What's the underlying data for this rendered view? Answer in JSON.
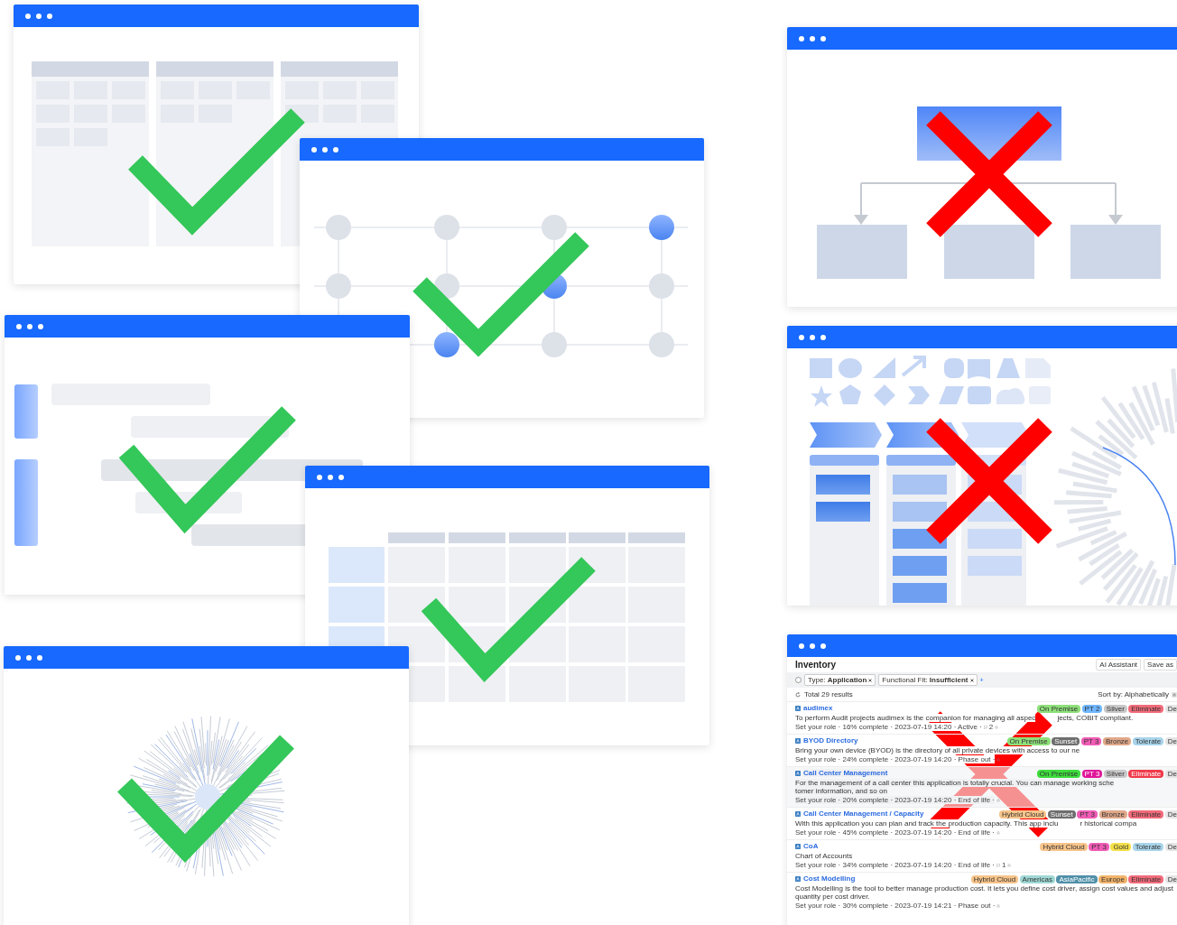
{
  "windows": [
    {
      "kind": "board",
      "approved": true
    },
    {
      "kind": "network",
      "approved": true
    },
    {
      "kind": "gantt",
      "approved": true
    },
    {
      "kind": "table",
      "approved": true
    },
    {
      "kind": "burst",
      "approved": true
    },
    {
      "kind": "flowchart",
      "approved": false
    },
    {
      "kind": "shapes",
      "approved": false
    },
    {
      "kind": "inventory",
      "approved": false,
      "inventory": {
        "title": "Inventory",
        "actions": [
          "AI Assistant",
          "Save as"
        ],
        "filters": [
          "Type: **Application**",
          "Functional Fit: **Insufficient**"
        ],
        "add_filter": "+",
        "total": "Total 29 results",
        "sort": "Sort by: Alphabetically",
        "items": [
          {
            "name": "audimex",
            "selected": false,
            "description": [
              "To perform Audit projects audimex is the companion for managing all aspec",
              "jects, COBIT compliant."
            ],
            "meta": "Set your role · 16% complete · 2023-07-19 14:20 · Active ·",
            "comments": "2",
            "tags": [
              {
                "label": "On Premise",
                "color": "#8ee07a"
              },
              {
                "label": "PT 2",
                "color": "#6fb6ff"
              },
              {
                "label": "Silver",
                "color": "#c8c8c8"
              },
              {
                "label": "Eliminate",
                "color": "#f26b7a"
              },
              {
                "label": "De",
                "color": "#e5e5e5"
              }
            ]
          },
          {
            "name": "BYOD Directory",
            "selected": false,
            "description": [
              "Bring your own device (BYOD) is the directory of all private devices with access to our ne"
            ],
            "meta": "Set your role · 24% complete · 2023-07-19 14:20 · Phase out ·",
            "tags": [
              {
                "label": "On Premise",
                "color": "#8ee07a"
              },
              {
                "label": "Sunset",
                "color": "#6e6e6e"
              },
              {
                "label": "PT 3",
                "color": "#f05cb5"
              },
              {
                "label": "Bronze",
                "color": "#e0a88a"
              },
              {
                "label": "Tolerate",
                "color": "#a8d4ea"
              },
              {
                "label": "De",
                "color": "#e5e5e5"
              }
            ]
          },
          {
            "name": "Call Center Management",
            "selected": true,
            "description": [
              "For the management of a call center this application is totally crucial. You can manage working sche",
              "tomer information, and so on"
            ],
            "meta": "Set your role · 20% complete · 2023-07-19 14:20 · End of life ·",
            "tags": [
              {
                "label": "On Premise",
                "color": "#3ddc3d"
              },
              {
                "label": "PT 3",
                "color": "#e0179a"
              },
              {
                "label": "Silver",
                "color": "#c8c8c8"
              },
              {
                "label": "Eliminate",
                "color": "#f03a4a"
              },
              {
                "label": "De",
                "color": "#e5e5e5"
              }
            ]
          },
          {
            "name": "Call Center Management / Capacity",
            "selected": false,
            "description": [
              "With this application you can plan and track the production capacity. This app inclu",
              "r historical compa"
            ],
            "meta": "Set your role · 45% complete · 2023-07-19 14:20 · End of life ·",
            "tags": [
              {
                "label": "Hybrid Cloud",
                "color": "#f7c48a"
              },
              {
                "label": "Sunset",
                "color": "#6e6e6e"
              },
              {
                "label": "PT 3",
                "color": "#f05cb5"
              },
              {
                "label": "Bronze",
                "color": "#e0a88a"
              },
              {
                "label": "Eliminate",
                "color": "#f26b7a"
              },
              {
                "label": "De",
                "color": "#e5e5e5"
              }
            ]
          },
          {
            "name": "CoA",
            "selected": false,
            "description": [
              "Chart of Accounts"
            ],
            "meta": "Set your role · 34% complete · 2023-07-19 14:20 · End of life ·",
            "comments": "1",
            "tags": [
              {
                "label": "Hybrid Cloud",
                "color": "#f7c48a"
              },
              {
                "label": "PT 3",
                "color": "#f05cb5"
              },
              {
                "label": "Gold",
                "color": "#f5e04a"
              },
              {
                "label": "Tolerate",
                "color": "#a8d4ea"
              },
              {
                "label": "De",
                "color": "#e5e5e5"
              }
            ]
          },
          {
            "name": "Cost Modelling",
            "selected": false,
            "description": [
              "Cost Modelling is the tool to better manage production cost. It lets you define cost driver, assign cost values and adjust quantity per cost driver."
            ],
            "meta": "Set your role · 30% complete · 2023-07-19 14:21 · Phase out ·",
            "tags": [
              {
                "label": "Hybrid Cloud",
                "color": "#f7c48a"
              },
              {
                "label": "Americas",
                "color": "#9fd8d4"
              },
              {
                "label": "AsiaPacific",
                "color": "#4f8fa8"
              },
              {
                "label": "Europe",
                "color": "#f2b36a"
              },
              {
                "label": "Eliminate",
                "color": "#f26b7a"
              },
              {
                "label": "De",
                "color": "#e5e5e5"
              }
            ]
          }
        ]
      }
    }
  ]
}
